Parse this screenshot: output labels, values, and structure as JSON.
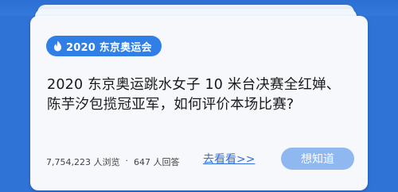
{
  "card": {
    "tag_icon": "flame-icon",
    "tag_label": "2020 东京奥运会",
    "question_line1": "2020 东京奥运跳水女子 10 米台决赛全红婵、",
    "question_line2": "陈芋汐包揽冠亚军，如何评价本场比赛?",
    "views": "7,754,223 人浏览",
    "separator": "·",
    "answers": "647 人回答",
    "link_label": "去看看>>",
    "button_label": "想知道"
  },
  "colors": {
    "background": "#2f73d6",
    "card": "#f7f8fb",
    "tag": "#2f7fe6",
    "link": "#2f6fe0",
    "button": "#8fb7f0"
  }
}
